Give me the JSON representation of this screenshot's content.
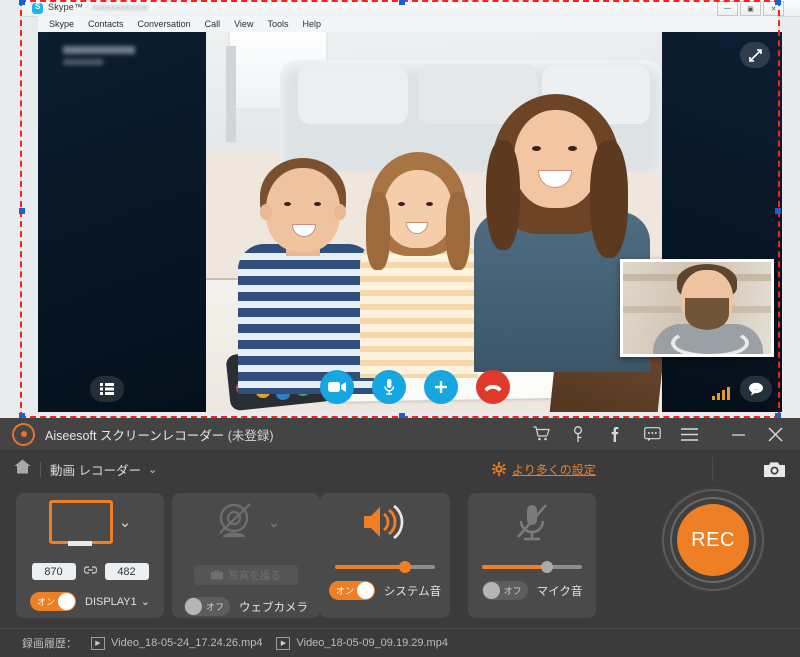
{
  "skype": {
    "app_title": "Skype™",
    "account_name": "",
    "menu_items": [
      "Skype",
      "Contacts",
      "Conversation",
      "Call",
      "View",
      "Tools",
      "Help"
    ],
    "window_buttons": [
      {
        "name": "minimize",
        "glyph": "—"
      },
      {
        "name": "maximize",
        "glyph": "▣"
      },
      {
        "name": "close",
        "glyph": "✕"
      }
    ],
    "call_controls": [
      {
        "name": "video-toggle-button",
        "icon": "video-camera-icon",
        "glyph": "▭",
        "color": "#16a6e0"
      },
      {
        "name": "mute-button",
        "icon": "microphone-icon",
        "glyph": "🎙",
        "color": "#16a6e0"
      },
      {
        "name": "add-participant-button",
        "icon": "plus-icon",
        "glyph": "+",
        "color": "#16a6e0"
      },
      {
        "name": "hang-up-button",
        "icon": "phone-hangup-icon",
        "glyph": "✆",
        "color": "#e13a2b"
      }
    ],
    "overlay_icons": {
      "menu": "list-icon",
      "expand": "fullscreen-icon",
      "chat": "chat-bubble-icon",
      "signal": "signal-strength-icon"
    }
  },
  "recorder": {
    "title": "Aiseesoft スクリーンレコーダー",
    "registration_status": "(未登録)",
    "titlebar_icons": [
      {
        "name": "cart-icon",
        "label": "cart"
      },
      {
        "name": "key-icon",
        "label": "register"
      },
      {
        "name": "facebook-icon",
        "label": "facebook"
      },
      {
        "name": "feedback-icon",
        "label": "feedback"
      },
      {
        "name": "menu-icon",
        "label": "menu"
      },
      {
        "name": "minimize-icon",
        "label": "minimize"
      },
      {
        "name": "close-icon",
        "label": "close"
      }
    ],
    "subbar": {
      "home_icon": "home-icon",
      "mode_label": "動画 レコーダー",
      "mode_chevron": "⌄",
      "more_settings_label": "より多くの設定",
      "more_settings_color": "#ef7f24",
      "snapshot_icon": "camera-icon"
    },
    "panels": {
      "display": {
        "icon": "monitor-icon",
        "chevron": "⌄",
        "width_value": "870",
        "height_value": "482",
        "link_icon": "chain-link-icon",
        "toggle_state": "on",
        "toggle_label": "オン",
        "source_label": "DISPLAY1",
        "source_chevron": "⌄"
      },
      "webcam": {
        "icon": "webcam-disabled-icon",
        "chevron": "⌄",
        "snapshot_button_label": "写真を撮る",
        "toggle_state": "off",
        "toggle_label": "オフ",
        "label": "ウェブカメラ"
      },
      "system_sound": {
        "icon": "speaker-icon",
        "volume_percent": 70,
        "toggle_state": "on",
        "toggle_label": "オン",
        "label": "システム音"
      },
      "microphone": {
        "icon": "microphone-muted-icon",
        "volume_percent": 65,
        "toggle_state": "off",
        "toggle_label": "オフ",
        "label": "マイク音"
      }
    },
    "record_button": {
      "label": "REC",
      "color": "#ef7f24"
    },
    "footer": {
      "history_label": "録画履歴：",
      "files": [
        {
          "name": "Video_18-05-24_17.24.26.mp4",
          "icon": "video-file-icon"
        },
        {
          "name": "Video_18-05-09_09.19.29.mp4",
          "icon": "video-file-icon"
        }
      ]
    }
  },
  "capture_frame": {
    "border_color": "#ff1d1d",
    "handle_color": "#1d60d6"
  }
}
